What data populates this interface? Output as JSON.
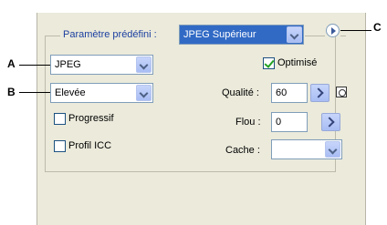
{
  "preset": {
    "label": "Paramètre prédéfini :",
    "value": "JPEG Supérieur"
  },
  "format": {
    "value": "JPEG"
  },
  "quality_preset": {
    "value": "Elevée"
  },
  "optimized": {
    "label": "Optimisé",
    "checked": true
  },
  "quality": {
    "label": "Qualité :",
    "value": "60"
  },
  "blur": {
    "label": "Flou :",
    "value": "0"
  },
  "matte": {
    "label": "Cache :",
    "value": ""
  },
  "progressive": {
    "label": "Progressif",
    "checked": false
  },
  "icc_profile": {
    "label": "Profil ICC",
    "checked": false
  },
  "callouts": {
    "a": "A",
    "b": "B",
    "c": "C"
  }
}
